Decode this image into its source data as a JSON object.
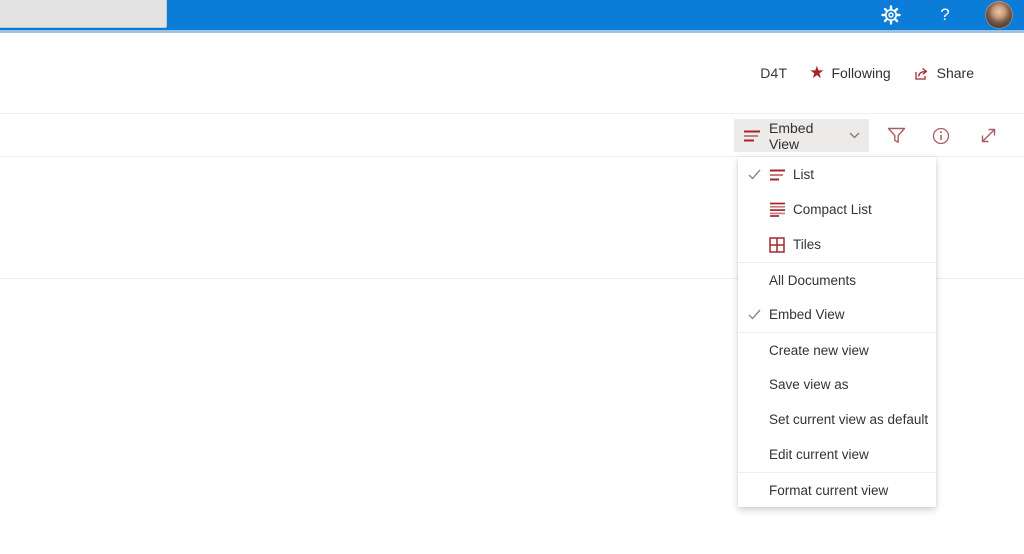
{
  "suite_bar": {
    "help_label": "?",
    "icons": [
      "gear-icon",
      "help-icon",
      "user-avatar"
    ]
  },
  "header": {
    "site_label": "D4T",
    "following_label": "Following",
    "share_label": "Share"
  },
  "command_bar": {
    "view_selector_label": "Embed View",
    "icons": [
      "filter-icon",
      "info-icon",
      "expand-icon"
    ]
  },
  "dropdown": {
    "items": [
      {
        "label": "List",
        "checked": true,
        "icon": "list-view-icon"
      },
      {
        "label": "Compact List",
        "checked": false,
        "icon": "compact-list-icon"
      },
      {
        "label": "Tiles",
        "checked": false,
        "icon": "tiles-icon"
      },
      {
        "label": "All Documents",
        "checked": false,
        "separator": true
      },
      {
        "label": "Embed View",
        "checked": true
      },
      {
        "label": "Create new view",
        "checked": false,
        "separator": true
      },
      {
        "label": "Save view as",
        "checked": false
      },
      {
        "label": "Set current view as default",
        "checked": false
      },
      {
        "label": "Edit current view",
        "checked": false
      },
      {
        "label": "Format current view",
        "checked": false,
        "separator": true
      }
    ]
  },
  "colors": {
    "suite_blue": "#0b7cd8",
    "accent_strip": "#9cc3e5",
    "accent_red": "#a4262c",
    "command_icon_red": "#a85d63",
    "text": "#323130",
    "divider": "#ededed",
    "button_bg": "#edebe9"
  }
}
